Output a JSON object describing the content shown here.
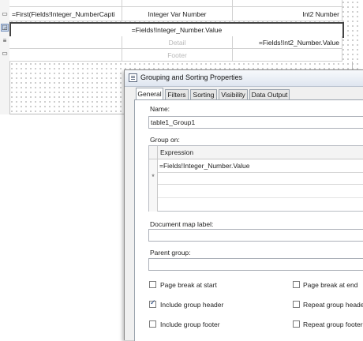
{
  "designer": {
    "header_row": {
      "col1": "=First(Fields!Integer_NumberCapti",
      "col2": "Integer Var Number",
      "col3": "Int2 Number"
    },
    "group_row": {
      "col1": "=Fields!Integer_Number.Value"
    },
    "detail_row": {
      "col2": "Detail",
      "col3": "=Fields!Int2_Number.Value"
    },
    "footer_row": {
      "col2": "Footer"
    },
    "gutter_icons": [
      "table-header-icon",
      "group-icon",
      "detail-icon",
      "footer-icon"
    ]
  },
  "dialog": {
    "title": "Grouping and Sorting Properties",
    "tabs": [
      "General",
      "Filters",
      "Sorting",
      "Visibility",
      "Data Output"
    ],
    "active_tab": "General",
    "name_label": "Name:",
    "name_value": "table1_Group1",
    "group_on_label": "Group on:",
    "expression_header": "Expression",
    "expressions": [
      "=Fields!Integer_Number.Value",
      ""
    ],
    "doc_map_label": "Document map label:",
    "doc_map_value": "",
    "parent_group_label": "Parent group:",
    "parent_group_value": "",
    "checkboxes": [
      {
        "label": "Page break at start",
        "checked": false
      },
      {
        "label": "Page break at end",
        "checked": false
      },
      {
        "label": "Include group header",
        "checked": true
      },
      {
        "label": "Repeat group header",
        "checked": false
      },
      {
        "label": "Include group footer",
        "checked": false
      },
      {
        "label": "Repeat group footer",
        "checked": false
      }
    ]
  }
}
